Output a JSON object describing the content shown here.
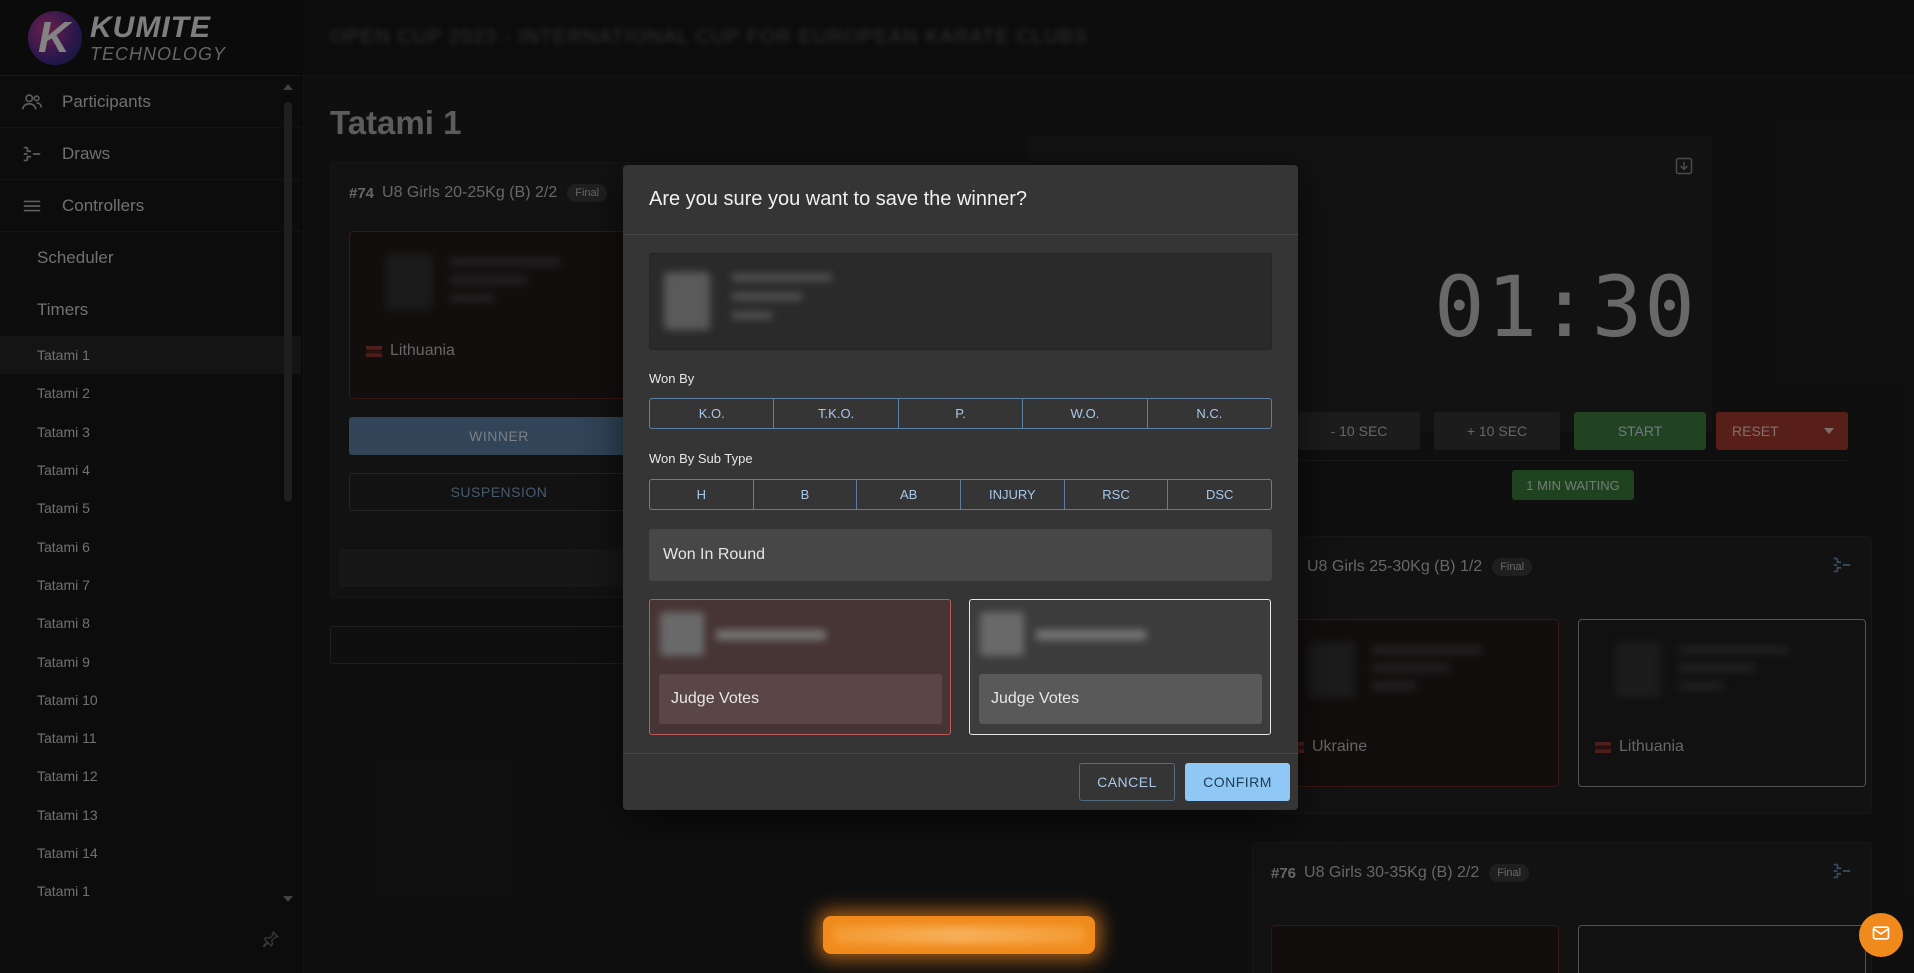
{
  "brand": {
    "name": "KUMITE",
    "subtitle": "TECHNOLOGY"
  },
  "topbar": {
    "title": "OPEN CUP 2023 - INTERNATIONAL CUP FOR EUROPEAN KARATE CLUBS"
  },
  "sidebar": {
    "main_items": [
      {
        "label": "Participants",
        "icon": "participants-icon"
      },
      {
        "label": "Draws",
        "icon": "draws-icon"
      },
      {
        "label": "Controllers",
        "icon": "controllers-icon"
      }
    ],
    "sub_items": [
      {
        "label": "Scheduler"
      },
      {
        "label": "Timers"
      }
    ],
    "tatamis": [
      "Tatami 1",
      "Tatami 2",
      "Tatami 3",
      "Tatami 4",
      "Tatami 5",
      "Tatami 6",
      "Tatami 7",
      "Tatami 8",
      "Tatami 9",
      "Tatami 10",
      "Tatami 11",
      "Tatami 12",
      "Tatami 13",
      "Tatami 14",
      "Tatami 1"
    ],
    "active_tatami": "Tatami 1"
  },
  "page": {
    "title": "Tatami 1"
  },
  "match_main": {
    "number": "#74",
    "title": "U8 Girls 20-25Kg (B) 2/2",
    "badge": "Final",
    "fighter_country": "Lithuania",
    "winner_label": "WINNER",
    "suspension_label": "SUSPENSION"
  },
  "timer": {
    "value": "01:30",
    "minus_label": "- 10 SEC",
    "plus_label": "+ 10 SEC",
    "start_label": "START",
    "reset_label": "RESET",
    "waiting_label": "1 MIN WAITING"
  },
  "match_next": {
    "number": "",
    "title": "U8 Girls 25-30Kg (B) 1/2",
    "badge": "Final",
    "red_country": "Ukraine",
    "white_country": "Lithuania"
  },
  "match_third": {
    "number": "#76",
    "title": "U8 Girls 30-35Kg (B) 2/2",
    "badge": "Final"
  },
  "modal": {
    "title": "Are you sure you want to save the winner?",
    "won_by_label": "Won By",
    "won_by_options": [
      "K.O.",
      "T.K.O.",
      "P.",
      "W.O.",
      "N.C."
    ],
    "sub_type_label": "Won By Sub Type",
    "sub_type_options": [
      "H",
      "B",
      "AB",
      "INJURY",
      "RSC",
      "DSC"
    ],
    "won_in_round_placeholder": "Won In Round",
    "red_judge_votes": "Judge Votes",
    "white_judge_votes": "Judge Votes",
    "cancel_label": "CANCEL",
    "confirm_label": "CONFIRM"
  },
  "colors": {
    "accent": "#90c8f5",
    "start": "#3f8a3f",
    "reset": "#c0392b",
    "fab": "#f08a1c"
  }
}
